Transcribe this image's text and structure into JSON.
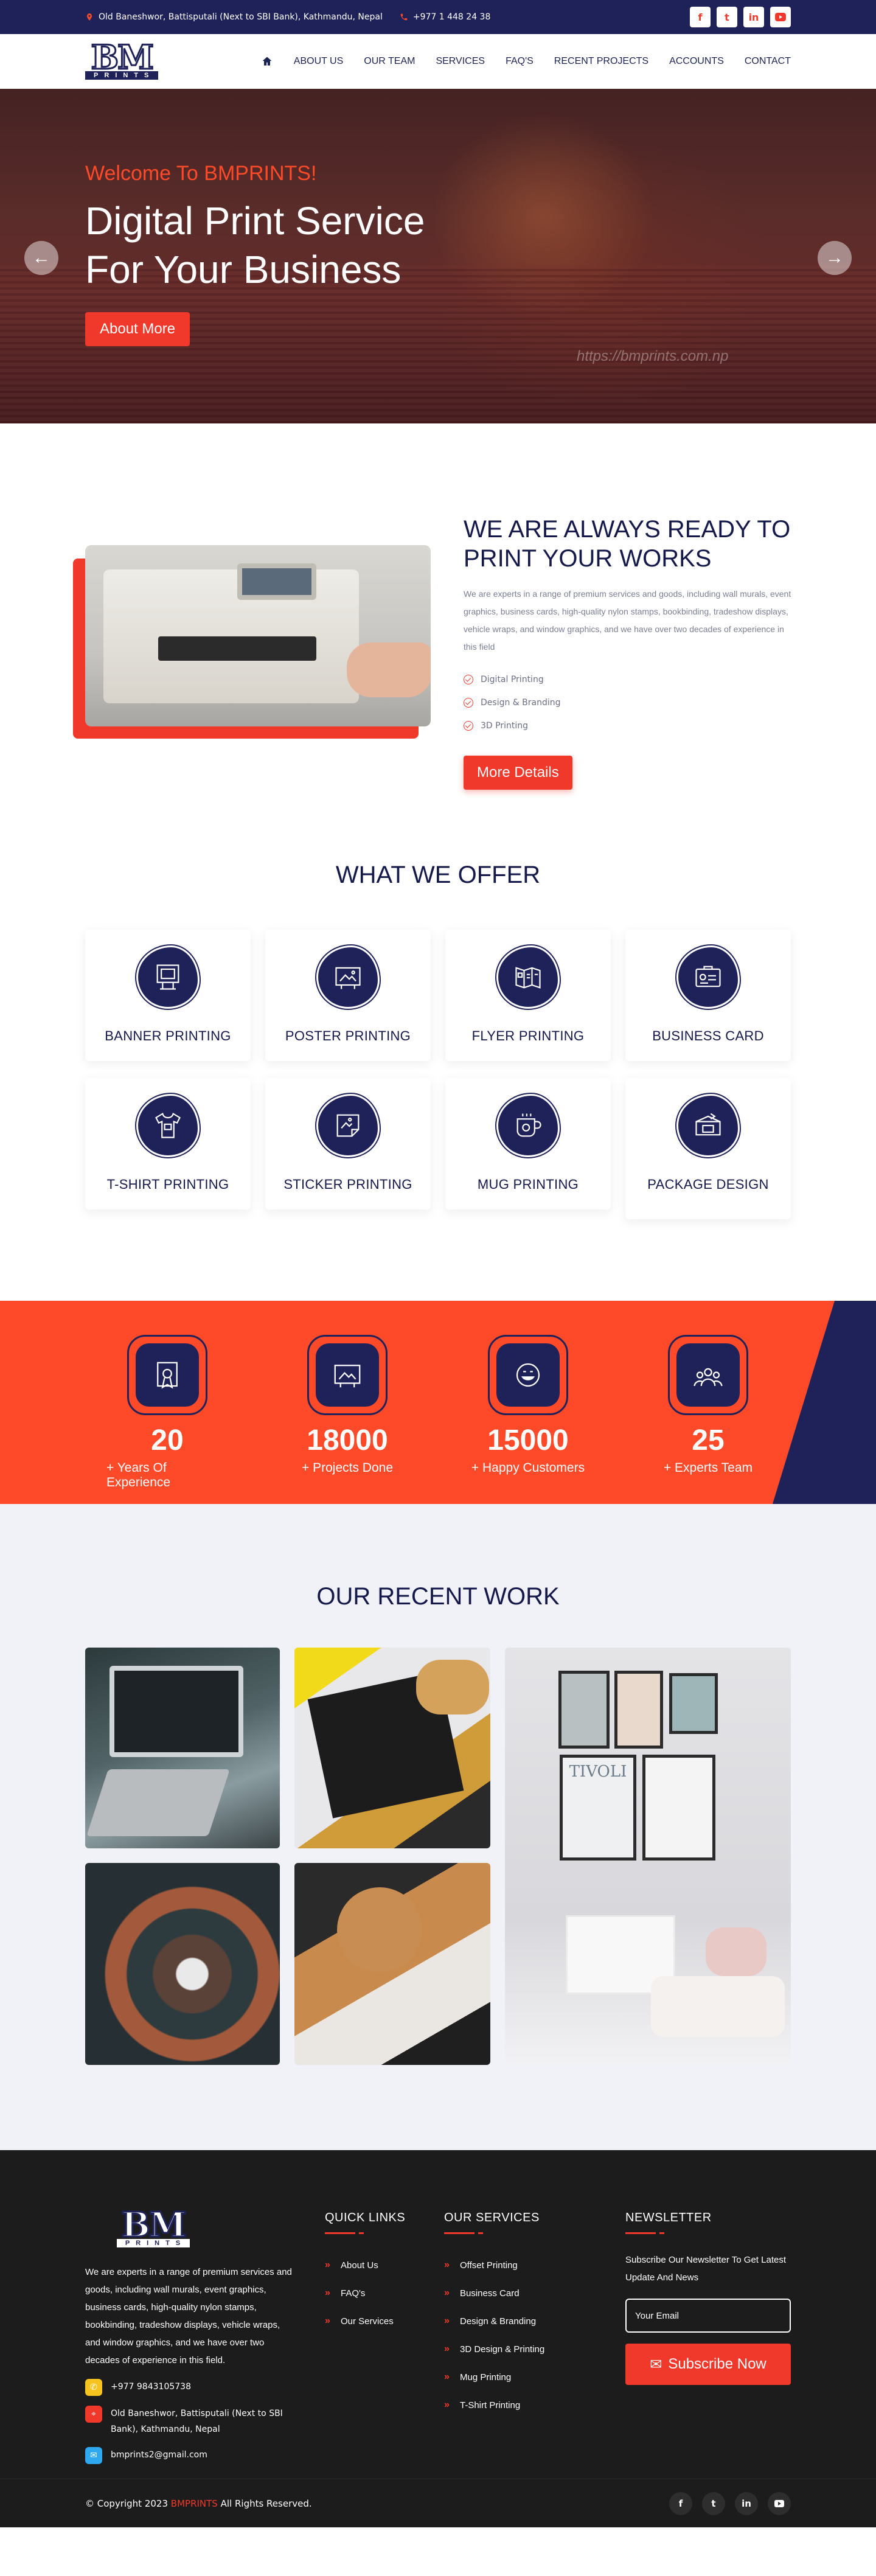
{
  "topbar": {
    "address": "Old Baneshwor, Battisputali (Next to SBI Bank), Kathmandu, Nepal",
    "phone": "+977 1 448 24 38",
    "social": [
      "f",
      "t",
      "in",
      "yt"
    ]
  },
  "nav": {
    "logo_mark": "BM",
    "logo_sub": "PRINTS",
    "items": [
      "ABOUT US",
      "OUR TEAM",
      "SERVICES",
      "FAQ'S",
      "RECENT PROJECTS",
      "ACCOUNTS",
      "CONTACT"
    ]
  },
  "hero": {
    "welcome": "Welcome To BMPRINTS!",
    "title_line1": "Digital Print Service",
    "title_line2": "For Your Business",
    "button": "About More",
    "watermark": "https://bmprints.com.np",
    "prev": "←",
    "next": "→"
  },
  "about": {
    "title_line1": "WE ARE ALWAYS READY TO",
    "title_line2": "PRINT YOUR WORKS",
    "body": "We are experts in a range of premium services and goods, including wall murals, event graphics, business cards, high-quality nylon stamps, bookbinding, tradeshow displays, vehicle wraps, and window graphics, and we have over two decades of experience in this field",
    "features": [
      "Digital Printing",
      "Design & Branding",
      "3D Printing"
    ],
    "button": "More Details"
  },
  "offer": {
    "title": "WHAT WE OFFER",
    "cards": [
      {
        "label": "BANNER PRINTING",
        "icon": "banner-icon"
      },
      {
        "label": "POSTER PRINTING",
        "icon": "poster-icon"
      },
      {
        "label": "FLYER PRINTING",
        "icon": "flyer-icon"
      },
      {
        "label": "BUSINESS CARD",
        "icon": "business-card-icon"
      },
      {
        "label": "T-SHIRT PRINTING",
        "icon": "tshirt-icon"
      },
      {
        "label": "STICKER PRINTING",
        "icon": "sticker-icon"
      },
      {
        "label": "MUG PRINTING",
        "icon": "mug-icon"
      },
      {
        "label": "PACKAGE DESIGN",
        "icon": "package-icon"
      }
    ]
  },
  "counters": [
    {
      "value": "20",
      "caption": "+ Years Of Experience",
      "icon": "certificate-icon"
    },
    {
      "value": "18000",
      "caption": "+ Projects Done",
      "icon": "projects-icon"
    },
    {
      "value": "15000",
      "caption": "+ Happy Customers",
      "icon": "smile-icon"
    },
    {
      "value": "25",
      "caption": "+ Experts Team",
      "icon": "team-icon"
    }
  ],
  "recent": {
    "title": "OUR RECENT WORK",
    "poster_text": "TIVOLI"
  },
  "footer": {
    "logo_mark": "BM",
    "logo_sub": "PRINTS",
    "about": "We are experts in a range of premium services and goods, including wall murals, event graphics, business cards, high-quality nylon stamps, bookbinding, tradeshow displays, vehicle wraps, and window graphics, and we have over two decades of experience in this field.",
    "phone": "+977 9843105738",
    "address": "Old Baneshwor, Battisputali (Next to SBI Bank), Kathmandu, Nepal",
    "email": "bmprints2@gmail.com",
    "quick_links_title": "QUICK LINKS",
    "quick_links": [
      "About Us",
      "FAQ's",
      "Our Services"
    ],
    "services_title": "OUR SERVICES",
    "services": [
      "Offset Printing",
      "Business Card",
      "Design & Branding",
      "3D Design & Printing",
      "Mug Printing",
      "T-Shirt Printing"
    ],
    "newsletter_title": "NEWSLETTER",
    "newsletter_text": "Subscribe Our Newsletter To Get Latest Update And News",
    "email_placeholder": "Your Email",
    "subscribe": "Subscribe Now",
    "copyright_prefix": "© Copyright 2023",
    "copyright_brand": "BMPRINTS",
    "copyright_suffix": "All Rights Reserved."
  },
  "colors": {
    "navy": "#1f2259",
    "accent": "#f0392b",
    "orange": "#ff4a2a",
    "footer": "#1c1c1c"
  }
}
